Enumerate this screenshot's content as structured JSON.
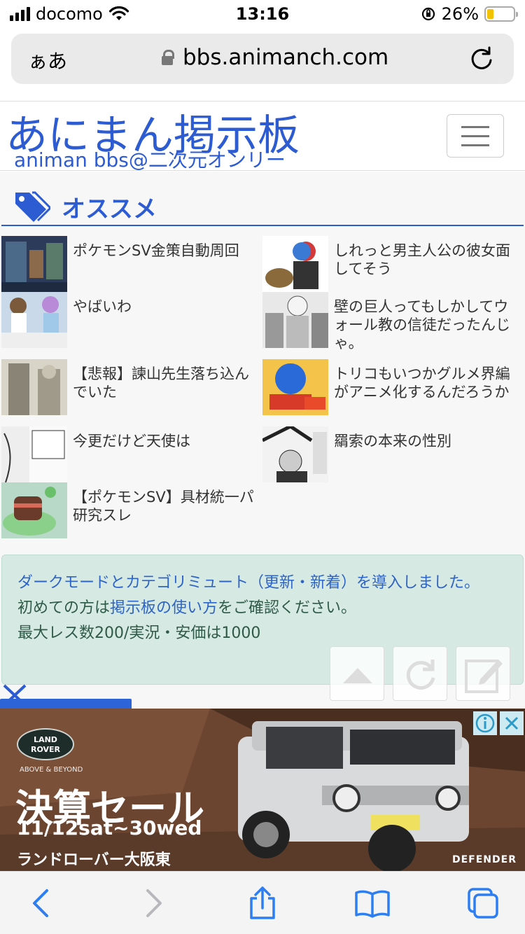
{
  "status_bar": {
    "carrier": "docomo",
    "time": "13:16",
    "battery_percent": "26%",
    "battery_level": 0.26
  },
  "address_bar": {
    "aa_label": "ぁあ",
    "url": "bbs.animanch.com"
  },
  "header": {
    "title": "あにまん掲示板",
    "subtitle": "animan bbs@二次元オンリー"
  },
  "section": {
    "title": "オススメ"
  },
  "items": [
    {
      "title": "ポケモンSV金策自動周回"
    },
    {
      "title": "しれっと男主人公の彼女面してそう"
    },
    {
      "title": "やばいわ"
    },
    {
      "title": "壁の巨人ってもしかしてウォール教の信徒だったんじゃ。"
    },
    {
      "title": "【悲報】諫山先生落ち込んでいた"
    },
    {
      "title": "トリコもいつかグルメ界編がアニメ化するんだろうか"
    },
    {
      "title": "今更だけど天使は"
    },
    {
      "title": "羂索の本来の性別"
    },
    {
      "title": "【ポケモンSV】具材統一パ研究スレ"
    }
  ],
  "notice": {
    "line1": "ダークモードとカテゴリミュート（更新・新着）を導入しました。",
    "line2_prefix": "初めての方は",
    "line2_link": "掲示板の使い方",
    "line2_suffix": "をご確認ください。",
    "line3": "最大レス数200/実況・安価は1000"
  },
  "ad": {
    "logo_line1": "LAND",
    "logo_line2": "ROVER",
    "tagline": "ABOVE & BEYOND",
    "headline": "決算セール",
    "date": "11/12sat~30wed",
    "store": "ランドローバー大阪東",
    "model": "DEFENDER",
    "info_icon": "ⓘ",
    "close_icon": "✕"
  },
  "colors": {
    "brand_blue": "#2d5bd2",
    "notice_bg": "#d6e9e3",
    "link_blue": "#2d64c8"
  }
}
